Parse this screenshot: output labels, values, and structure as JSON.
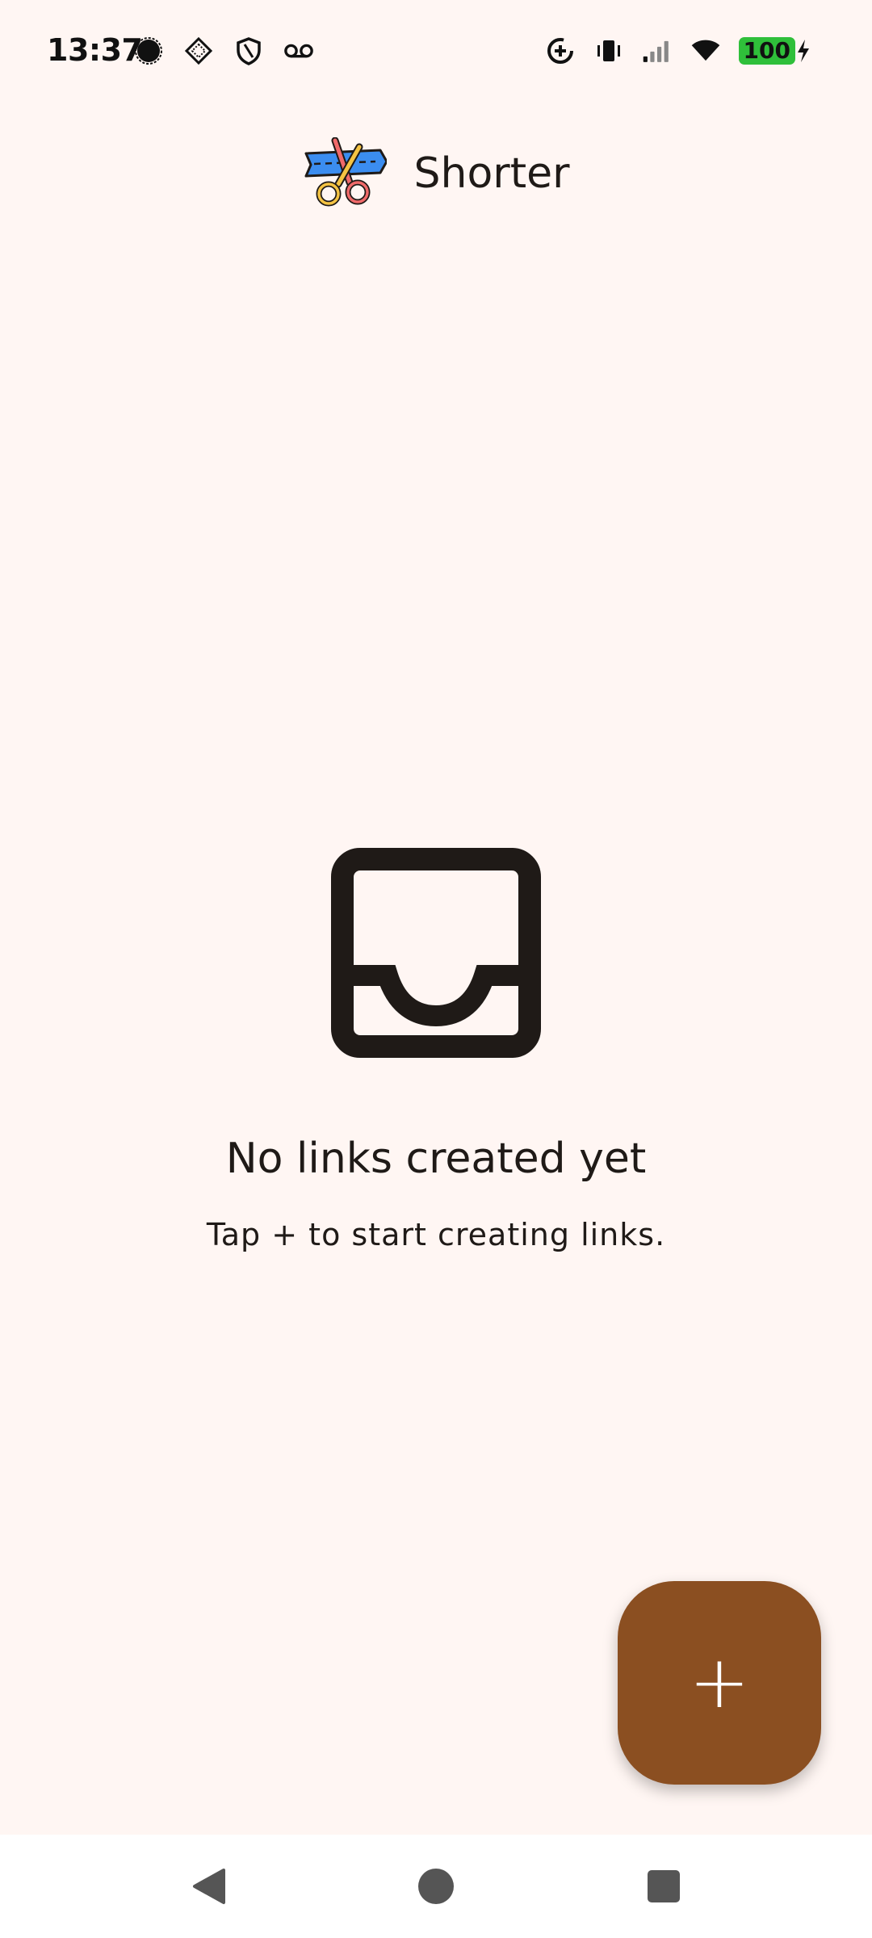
{
  "status_bar": {
    "time": "13:37",
    "left_icons": [
      "signal-app-icon",
      "location-diamond-icon",
      "shield-icon",
      "voicemail-icon"
    ],
    "right_icons": [
      "data-saver-icon",
      "vibrate-icon",
      "cell-signal-icon",
      "wifi-icon"
    ],
    "battery_level": "100",
    "battery_charging": true
  },
  "app_bar": {
    "title": "Shorter",
    "logo_icon": "scissors-ribbon-icon"
  },
  "empty_state": {
    "icon": "inbox-icon",
    "title": "No links created yet",
    "subtitle": "Tap + to start creating links."
  },
  "fab": {
    "label": "+",
    "icon": "add-icon",
    "color": "#8b4f21"
  },
  "nav_bar": {
    "buttons": [
      "back-icon",
      "home-icon",
      "recents-icon"
    ]
  },
  "colors": {
    "background": "#fff6f3",
    "text": "#1f1a17",
    "battery": "#2fbf3a"
  }
}
